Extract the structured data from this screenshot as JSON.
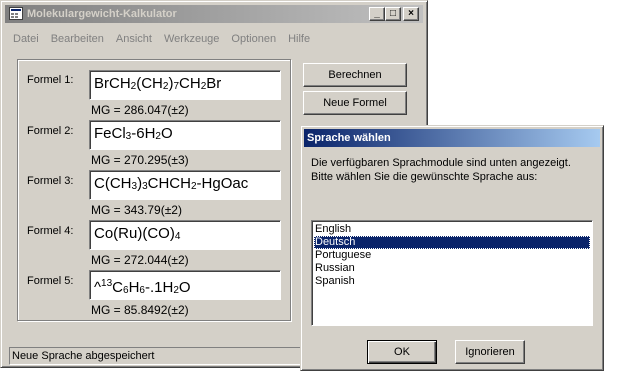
{
  "main_window": {
    "title": "Molekulargewicht-Kalkulator",
    "controls": {
      "minimize": "_",
      "maximize": "□",
      "close": "×"
    },
    "menu": [
      "Datei",
      "Bearbeiten",
      "Ansicht",
      "Werkzeuge",
      "Optionen",
      "Hilfe"
    ],
    "buttons": {
      "calculate": "Berechnen",
      "new_formula": "Neue Formel"
    },
    "formulas": [
      {
        "label": "Formel 1:",
        "mg": "MG = 286.047(±2)"
      },
      {
        "label": "Formel 2:",
        "mg": "MG = 270.295(±3)"
      },
      {
        "label": "Formel 3:",
        "mg": "MG = 343.79(±2)"
      },
      {
        "label": "Formel 4:",
        "mg": "MG = 272.044(±2)"
      },
      {
        "label": "Formel 5:",
        "mg": "MG = 85.8492(±2)"
      }
    ],
    "status": "Neue Sprache abgespeichert"
  },
  "dialog": {
    "title": "Sprache wählen",
    "instructions": "Die verfügbaren Sprachmodule sind unten angezeigt. Bitte wählen Sie die gewünschte Sprache aus:",
    "languages": [
      "English",
      "Deutsch",
      "Portuguese",
      "Russian",
      "Spanish"
    ],
    "selected_language": "Deutsch",
    "ok": "OK",
    "ignore": "Ignorieren"
  },
  "colors": {
    "face": "#d4d0c8",
    "active_title": "#0a246a",
    "inactive_title": "#808080",
    "selection": "#0a246a"
  }
}
